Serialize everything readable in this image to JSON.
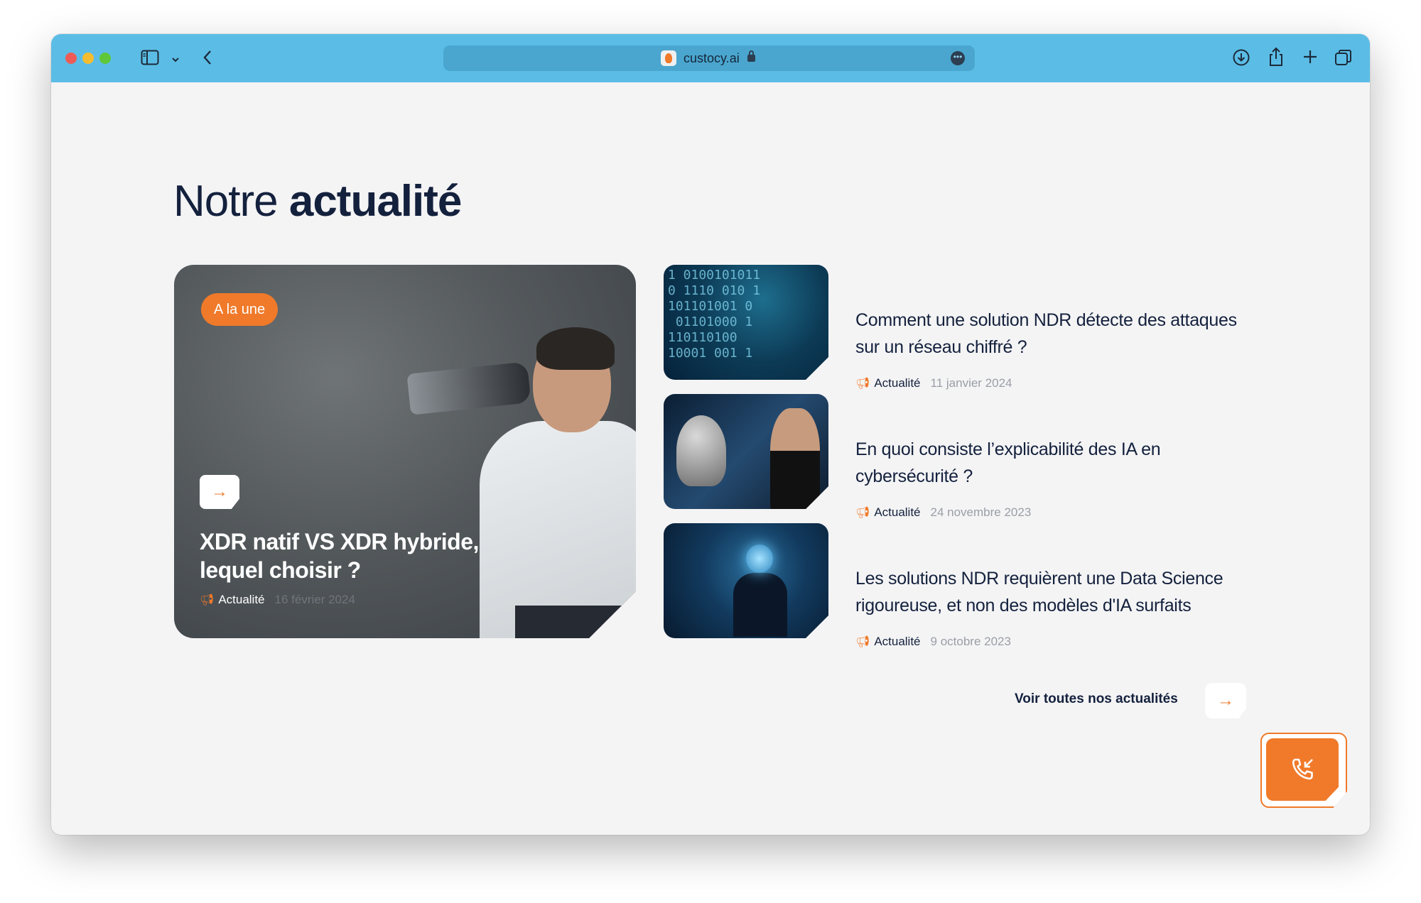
{
  "browser": {
    "url": "custocy.ai",
    "icons": [
      "sidebar-icon",
      "chevron-down-icon",
      "back-icon",
      "download-icon",
      "share-icon",
      "new-tab-icon",
      "tabs-icon"
    ]
  },
  "section": {
    "title_light": "Notre",
    "title_bold": "actualité"
  },
  "featured": {
    "badge": "A la une",
    "title": "XDR natif VS XDR hybride, lequel choisir ?",
    "category": "Actualité",
    "date": "16 février 2024"
  },
  "articles": [
    {
      "title": "Comment une solution NDR détecte des attaques sur un réseau chiffré ?",
      "category": "Actualité",
      "date": "11 janvier 2024"
    },
    {
      "title": "En quoi consiste l’explicabilité des IA en cybersécurité ?",
      "category": "Actualité",
      "date": "24 novembre 2023"
    },
    {
      "title": "Les solutions NDR requièrent une Data Science rigoureuse, et non des modèles d'IA surfaits",
      "category": "Actualité",
      "date": "9 octobre 2023"
    }
  ],
  "see_all": "Voir toutes nos actualités",
  "colors": {
    "accent": "#f07a2a",
    "titlebar": "#5bbde6",
    "text": "#14213d",
    "page_bg": "#f4f4f5"
  }
}
